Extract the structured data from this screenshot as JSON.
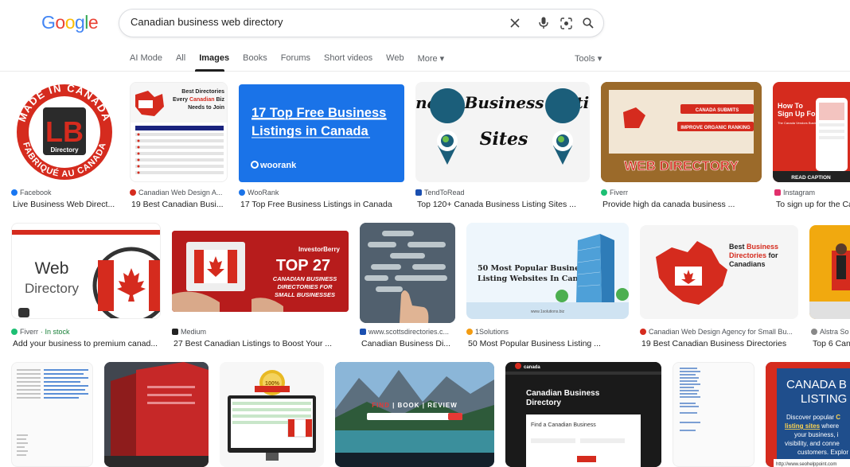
{
  "header": {
    "logo_letters": [
      "G",
      "o",
      "o",
      "g",
      "l",
      "e"
    ],
    "search_value": "Canadian business web directory",
    "icons": [
      "close-icon",
      "microphone-icon",
      "lens-icon",
      "search-icon"
    ]
  },
  "tabs": [
    "AI Mode",
    "All",
    "Images",
    "Books",
    "Forums",
    "Short videos",
    "Web",
    "More ▾"
  ],
  "active_tab": "Images",
  "tools_label": "Tools ▾",
  "colors": {
    "accent_blue": "#1a73e8",
    "canada_red": "#d52b1e"
  },
  "results_row1": [
    {
      "source": "Facebook",
      "title": "Live Business Web Direct...",
      "fav": "#1877f2"
    },
    {
      "source": "Canadian Web Design A...",
      "title": "19 Best Canadian Busi...",
      "fav": "#d52b1e"
    },
    {
      "source": "WooRank",
      "title": "17 Top Free Business Listings in Canada",
      "fav": "#1a73e8"
    },
    {
      "source": "TendToRead",
      "title": "Top 120+ Canada Business Listing Sites ...",
      "fav": "#1a4fb0"
    },
    {
      "source": "Fiverr",
      "title": "Provide high da canada business ...",
      "fav": "#1dbf73"
    },
    {
      "source": "Instagram",
      "title": "To sign up for the Ca",
      "fav": "#e1306c"
    }
  ],
  "results_row2": [
    {
      "source": "Fiverr",
      "source_extra": " · In stock",
      "title": "Add your business to premium canad...",
      "fav": "#1dbf73"
    },
    {
      "source": "Medium",
      "title": "27 Best Canadian Listings to Boost Your ...",
      "fav": "#222222"
    },
    {
      "source": "www.scottsdirectories.c...",
      "title": "Canadian Business Di...",
      "fav": "#1a4fb0"
    },
    {
      "source": "1Solutions",
      "title": "50 Most Popular Business Listing ...",
      "fav": "#f39c12"
    },
    {
      "source": "Canadian Web Design Agency for Small Bu...",
      "title": "19 Best Canadian Business Directories",
      "fav": "#d52b1e"
    },
    {
      "source": "Alstra So",
      "title": "Top 6 Can",
      "fav": "#888888"
    }
  ],
  "thumb_text": {
    "t1": {
      "line1": "MADE IN CANADA",
      "line2": "FABRIQUÉ AU CANADA",
      "mono": "LB",
      "sub": "Directory"
    },
    "t2": {
      "line1": "Best Directories",
      "line2a": "Every ",
      "line2b": "Canadian",
      "line2c": " Biz",
      "line3": "Needs to Join"
    },
    "t3": {
      "line1": "17 Top Free Business",
      "line2": "Listings in Canada",
      "brand": "woorank"
    },
    "t4": {
      "line1": "Canada Business Listing",
      "line2": "Sites"
    },
    "t5": {
      "banner": "WEB DIRECTORY",
      "tag1": "CANADA SUBMITS",
      "tag2": "IMPROVE ORGANIC RANKING"
    },
    "t6": {
      "line1": "How To",
      "line2": "Sign Up For",
      "sub": "The Canada Vendors Business Directory",
      "cap": "READ CAPTION"
    },
    "t7": {
      "line1": "Web",
      "line2": "Directory"
    },
    "t8": {
      "brand": "InvestorBerry",
      "big": "TOP 27",
      "l1": "CANADIAN BUSINESS",
      "l2": "DIRECTORIES FOR",
      "l3": "SMALL BUSINESSES"
    },
    "t10": {
      "l1": "50 Most Popular Business",
      "l2": "Listing Websites In Canada",
      "foot": "www.1solutions.biz"
    },
    "t11": {
      "l1": "Best ",
      "l1b": "Business",
      "l2a": "Directories",
      "l2b": " for",
      "l3": "Canadians"
    },
    "t15": {
      "search": "FIND",
      "book": "BOOK",
      "review": "REVIEW"
    },
    "t16": {
      "brand": "canada",
      "l1": "Canadian Business",
      "l2": "Directory",
      "find": "Find a Canadian Business"
    },
    "t18": {
      "l1": "CANADA B",
      "l2": "LISTING",
      "s1": "Discover popular ",
      "s1b": "C",
      "s2": "listing sites",
      "s2b": " where",
      "s3": "your business, i",
      "s4": "visibility, and conne",
      "s5": "customers. Explor",
      "url": "http://www.seohelppoint.com"
    },
    "t14": {
      "seal": "100%"
    }
  }
}
